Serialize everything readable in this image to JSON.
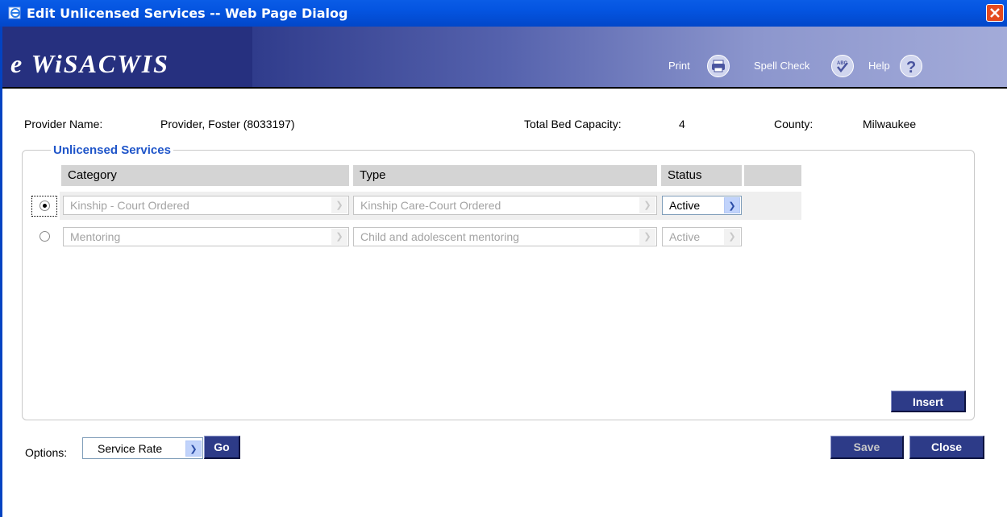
{
  "window": {
    "title": "Edit Unlicensed Services -- Web Page Dialog"
  },
  "banner": {
    "logo": "e WiSACWIS",
    "print_label": "Print",
    "spellcheck_label": "Spell Check",
    "help_label": "Help"
  },
  "provider": {
    "name_label": "Provider Name:",
    "name_value": "Provider, Foster (8033197)",
    "bed_label": "Total Bed Capacity:",
    "bed_value": "4",
    "county_label": "County:",
    "county_value": "Milwaukee"
  },
  "services": {
    "legend": "Unlicensed Services",
    "columns": [
      "Category",
      "Type",
      "Status",
      ""
    ],
    "rows": [
      {
        "selected": true,
        "category": "Kinship - Court Ordered",
        "type": "Kinship Care-Court Ordered",
        "status": "Active",
        "status_enabled": true
      },
      {
        "selected": false,
        "category": "Mentoring",
        "type": "Child and adolescent mentoring",
        "status": "Active",
        "status_enabled": false
      }
    ],
    "insert_label": "Insert"
  },
  "footer": {
    "options_label": "Options:",
    "options_value": "Service Rate",
    "go_label": "Go",
    "save_label": "Save",
    "close_label": "Close"
  },
  "colors": {
    "titlebar": "#0454e0",
    "banner_dark": "#26307f",
    "button": "#2d3b88",
    "legend_text": "#1f55c9"
  },
  "icons": [
    "ie-page-icon",
    "close-icon",
    "printer-icon",
    "spellcheck-icon",
    "help-icon",
    "chevron-down-icon"
  ]
}
